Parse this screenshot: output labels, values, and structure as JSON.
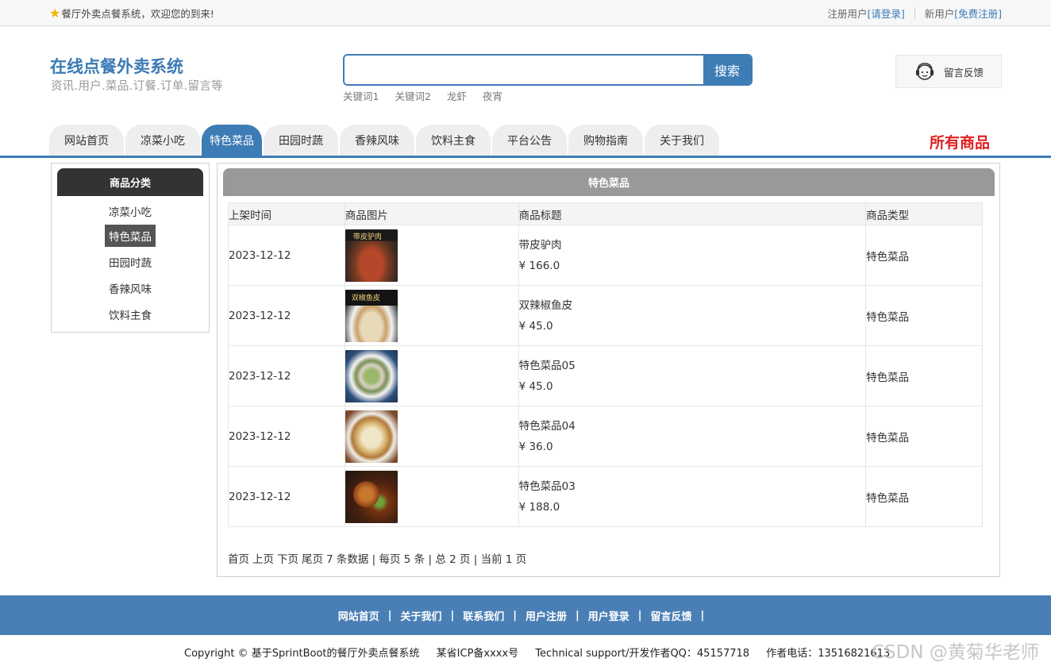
{
  "topbar": {
    "welcome": "餐厅外卖点餐系统，欢迎您的到来!",
    "registered_user": "注册用户",
    "login_link": "[请登录]",
    "new_user": "新用户",
    "register_link": "[免费注册]"
  },
  "header": {
    "title": "在线点餐外卖系统",
    "subtitle": "资讯.用户.菜品.订餐.订单.留言等",
    "search_button": "搜索",
    "search_value": "",
    "keywords": [
      "关键词1",
      "关键词2",
      "龙虾",
      "夜宵"
    ],
    "feedback_label": "留言反馈"
  },
  "nav": {
    "tabs": [
      "网站首页",
      "凉菜小吃",
      "特色菜品",
      "田园时蔬",
      "香辣风味",
      "饮料主食",
      "平台公告",
      "购物指南",
      "关于我们"
    ],
    "active": "特色菜品",
    "all_goods": "所有商品"
  },
  "sidebar": {
    "title": "商品分类",
    "items": [
      "凉菜小吃",
      "特色菜品",
      "田园时蔬",
      "香辣风味",
      "饮料主食"
    ],
    "active": "特色菜品"
  },
  "main": {
    "title": "特色菜品",
    "columns": [
      "上架时间",
      "商品图片",
      "商品标题",
      "商品类型"
    ],
    "rows": [
      {
        "date": "2023-12-12",
        "title": "带皮驴肉",
        "price": "¥ 166.0",
        "type": "特色菜品",
        "image": "dish-donkey-meat"
      },
      {
        "date": "2023-12-12",
        "title": "双辣椒鱼皮",
        "price": "¥ 45.0",
        "type": "特色菜品",
        "image": "dish-fish-skin"
      },
      {
        "date": "2023-12-12",
        "title": "特色菜品05",
        "price": "¥ 45.0",
        "type": "特色菜品",
        "image": "dish-05"
      },
      {
        "date": "2023-12-12",
        "title": "特色菜品04",
        "price": "¥ 36.0",
        "type": "特色菜品",
        "image": "dish-04"
      },
      {
        "date": "2023-12-12",
        "title": "特色菜品03",
        "price": "¥ 188.0",
        "type": "特色菜品",
        "image": "dish-03"
      }
    ],
    "pager": {
      "first": "首页",
      "prev": "上页",
      "next": "下页",
      "last": "尾页",
      "info": "7 条数据 | 每页 5 条 | 总 2 页 | 当前 1 页"
    }
  },
  "footer": {
    "links": [
      "网站首页",
      "关于我们",
      "联系我们",
      "用户注册",
      "用户登录",
      "留言反馈"
    ],
    "copyright": "Copyright © 基于SprintBoot的餐厅外卖点餐系统",
    "icp": "某省ICP备xxxx号",
    "support": "Technical support/开发作者QQ：45157718",
    "phone": "作者电话：13516821613",
    "watermark": "CSDN @黄菊华老师"
  },
  "colors": {
    "accent": "#3e7cb5",
    "footer": "#4a7fb5",
    "highlight": "#e02020"
  }
}
